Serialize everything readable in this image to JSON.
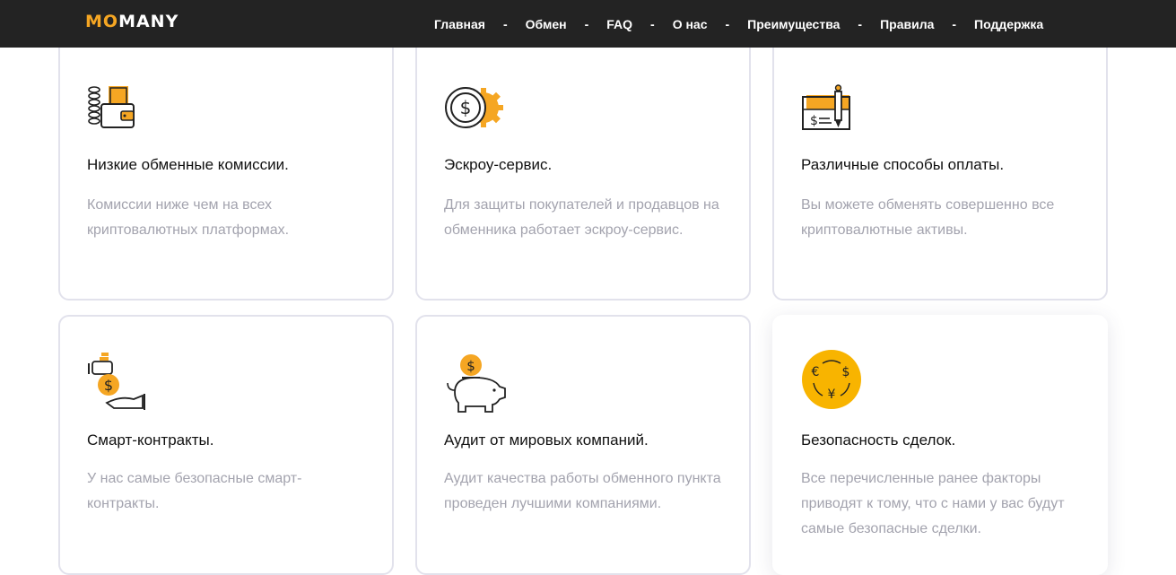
{
  "header": {
    "logo_accent": "MO",
    "logo_rest": "MANY",
    "nav": [
      "Главная",
      "Обмен",
      "FAQ",
      "О нас",
      "Преимущества",
      "Правила",
      "Поддержка"
    ],
    "separator": "-"
  },
  "features": [
    {
      "icon": "coins-wallet-icon",
      "title": "Низкие обменные комиссии.",
      "desc": "Комиссии ниже чем на всех криптовалютных платформах."
    },
    {
      "icon": "dollar-gear-icon",
      "title": "Эскроу-сервис.",
      "desc": "Для защиты покупателей и продавцов на обменника работает эскроу-сервис."
    },
    {
      "icon": "check-pen-icon",
      "title": "Различные способы оплаты.",
      "desc": "Вы можете обменять совершенно все криптовалютные активы."
    },
    {
      "icon": "hand-coin-icon",
      "title": "Смарт-контракты.",
      "desc": "У нас самые безопасные смарт-контракты."
    },
    {
      "icon": "piggy-bank-icon",
      "title": "Аудит от мировых компаний.",
      "desc": "Аудит качества работы обменного пункта проведен лучшими компаниями."
    },
    {
      "icon": "currency-exchange-icon",
      "title": "Безопасность сделок.",
      "desc": "Все перечисленные ранее факторы приводят к тому, что с нами у вас будут самые безопасные сделки."
    }
  ],
  "colors": {
    "accent": "#f5a623",
    "header_bg": "#232323",
    "card_border": "#e2e2ec",
    "desc_text": "#a3a3ae"
  }
}
